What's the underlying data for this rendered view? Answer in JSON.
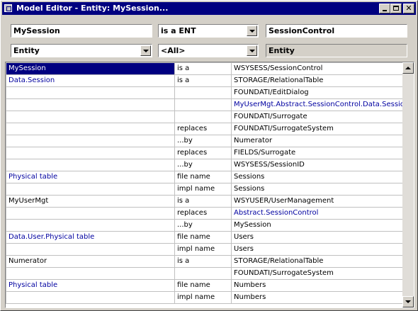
{
  "window": {
    "title": "Model Editor - Entity: MySession..."
  },
  "top_fields": {
    "name": "MySession",
    "relation": "is a ENT",
    "target": "SessionControl",
    "kind": "Entity",
    "filter": "<All>",
    "kind_display": "Entity"
  },
  "rows": [
    {
      "c1": "MySession",
      "c2": "is a",
      "c3": "WSYSESS/SessionControl",
      "c1_blue": false,
      "c3_blue": false,
      "selected": true
    },
    {
      "c1": "Data.Session",
      "c2": "is a",
      "c3": "STORAGE/RelationalTable",
      "c1_blue": true,
      "c3_blue": false
    },
    {
      "c1": "",
      "c2": "",
      "c3": "FOUNDATI/EditDialog",
      "c1_blue": false,
      "c3_blue": false
    },
    {
      "c1": "",
      "c2": "",
      "c3": "MyUserMgt.Abstract.SessionControl.Data.Session",
      "c1_blue": false,
      "c3_blue": true
    },
    {
      "c1": "",
      "c2": "",
      "c3": "FOUNDATI/Surrogate",
      "c1_blue": false,
      "c3_blue": false
    },
    {
      "c1": "",
      "c2": "replaces",
      "c3": "FOUNDATI/SurrogateSystem",
      "c1_blue": false,
      "c3_blue": false
    },
    {
      "c1": "",
      "c2": "...by",
      "c3": "Numerator",
      "c1_blue": false,
      "c3_blue": false
    },
    {
      "c1": "",
      "c2": "replaces",
      "c3": "FIELDS/Surrogate",
      "c1_blue": false,
      "c3_blue": false
    },
    {
      "c1": "",
      "c2": "...by",
      "c3": "WSYSESS/SessionID",
      "c1_blue": false,
      "c3_blue": false
    },
    {
      "c1": "Physical table",
      "c2": "file name",
      "c3": "Sessions",
      "c1_blue": true,
      "c3_blue": false
    },
    {
      "c1": "",
      "c2": "impl name",
      "c3": "Sessions",
      "c1_blue": false,
      "c3_blue": false
    },
    {
      "c1": "MyUserMgt",
      "c2": "is a",
      "c3": "WSYUSER/UserManagement",
      "c1_blue": false,
      "c3_blue": false
    },
    {
      "c1": "",
      "c2": "replaces",
      "c3": "Abstract.SessionControl",
      "c1_blue": false,
      "c3_blue": true
    },
    {
      "c1": "",
      "c2": "...by",
      "c3": "MySession",
      "c1_blue": false,
      "c3_blue": false
    },
    {
      "c1": "Data.User.Physical table",
      "c2": "file name",
      "c3": "Users",
      "c1_blue": true,
      "c3_blue": false
    },
    {
      "c1": "",
      "c2": "impl name",
      "c3": "Users",
      "c1_blue": false,
      "c3_blue": false
    },
    {
      "c1": "Numerator",
      "c2": "is a",
      "c3": "STORAGE/RelationalTable",
      "c1_blue": false,
      "c3_blue": false
    },
    {
      "c1": "",
      "c2": "",
      "c3": "FOUNDATI/SurrogateSystem",
      "c1_blue": false,
      "c3_blue": false
    },
    {
      "c1": "Physical table",
      "c2": "file name",
      "c3": "Numbers",
      "c1_blue": true,
      "c3_blue": false
    },
    {
      "c1": "",
      "c2": "impl name",
      "c3": "Numbers",
      "c1_blue": false,
      "c3_blue": false
    }
  ],
  "icons": {
    "window": "window-icon",
    "minimize": "minimize-icon",
    "maximize": "maximize-icon",
    "close": "close-icon"
  },
  "colors": {
    "title_bar": "#000080",
    "link_text": "#0000a0",
    "selection": "#000080"
  }
}
